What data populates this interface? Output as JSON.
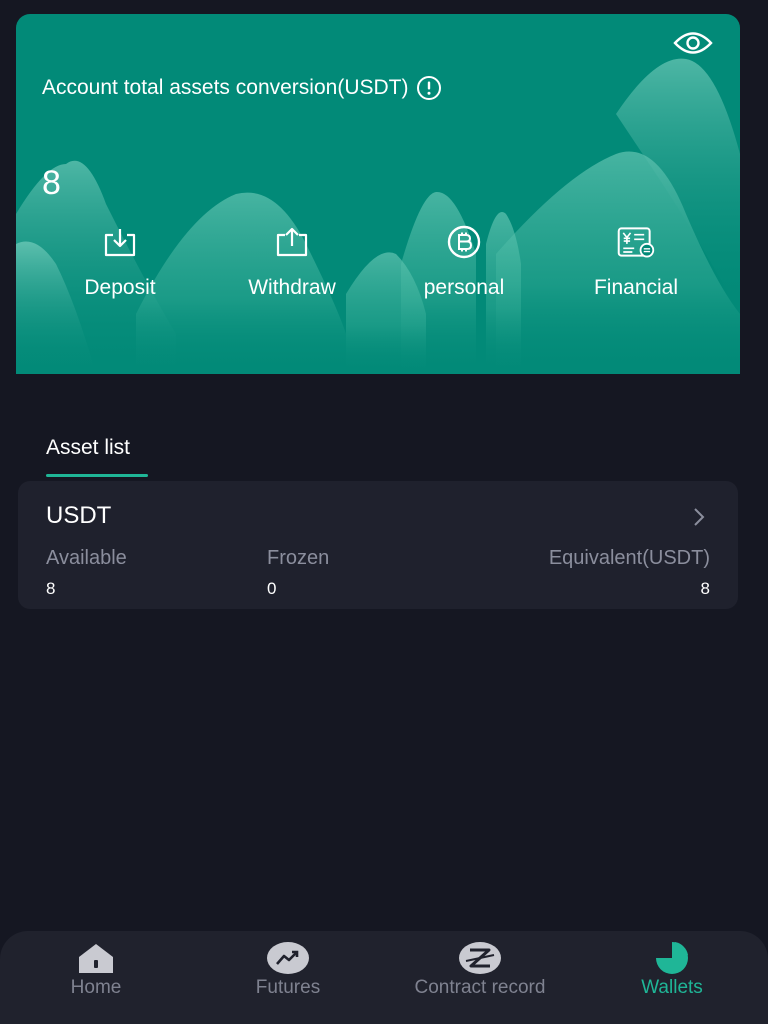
{
  "summary": {
    "title": "Account total assets conversion(USDT)",
    "total": "8"
  },
  "actions": [
    {
      "label": "Deposit",
      "icon": "deposit-icon"
    },
    {
      "label": "Withdraw",
      "icon": "withdraw-icon"
    },
    {
      "label": "personal",
      "icon": "bitcoin-icon"
    },
    {
      "label": "Financial",
      "icon": "financial-icon"
    }
  ],
  "asset_list": {
    "tab": "Asset list",
    "items": [
      {
        "name": "USDT",
        "available_label": "Available",
        "available": "8",
        "frozen_label": "Frozen",
        "frozen": "0",
        "equivalent_label": "Equivalent(USDT)",
        "equivalent": "8"
      }
    ]
  },
  "nav": [
    {
      "label": "Home",
      "icon": "home-icon",
      "active": false
    },
    {
      "label": "Futures",
      "icon": "futures-icon",
      "active": false
    },
    {
      "label": "Contract record",
      "icon": "contract-record-icon",
      "active": false
    },
    {
      "label": "Wallets",
      "icon": "wallets-icon",
      "active": true
    }
  ],
  "colors": {
    "card": "#028a78",
    "background": "#151722",
    "accent": "#1fb697",
    "panel": "#1f212d",
    "nav": "#20222d",
    "muted": "#8b8e9d"
  }
}
